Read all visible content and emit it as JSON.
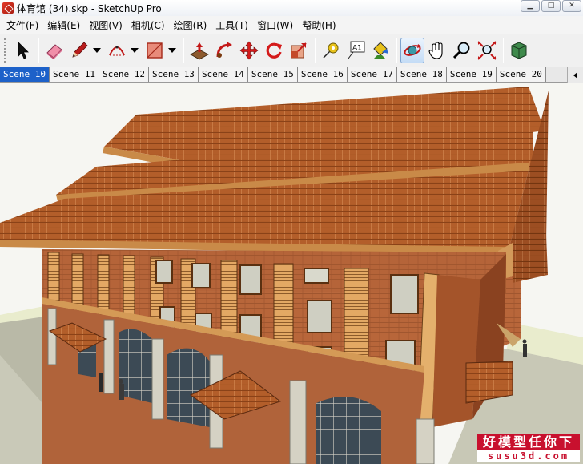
{
  "window": {
    "title": "体育馆 (34).skp - SketchUp Pro",
    "controls": {
      "minimize": "▁",
      "maximize": "□",
      "close": "✕"
    }
  },
  "menu": [
    {
      "label": "文件(F)"
    },
    {
      "label": "编辑(E)"
    },
    {
      "label": "视图(V)"
    },
    {
      "label": "相机(C)"
    },
    {
      "label": "绘图(R)"
    },
    {
      "label": "工具(T)"
    },
    {
      "label": "窗口(W)"
    },
    {
      "label": "帮助(H)"
    }
  ],
  "toolbar": {
    "tools": [
      {
        "icon": "select-icon"
      },
      {
        "icon": "eraser-icon"
      },
      {
        "icon": "pencil-icon",
        "dropdown": true
      },
      {
        "icon": "arc-icon",
        "dropdown": true
      },
      {
        "icon": "rectangle-icon",
        "dropdown": true
      },
      {
        "icon": "push-pull-icon"
      },
      {
        "icon": "follow-me-icon"
      },
      {
        "icon": "move-icon"
      },
      {
        "icon": "rotate-icon"
      },
      {
        "icon": "scale-icon"
      },
      {
        "icon": "tape-measure-icon"
      },
      {
        "icon": "text-icon",
        "label": "A1"
      },
      {
        "icon": "paint-bucket-icon"
      },
      {
        "icon": "orbit-icon",
        "active": true
      },
      {
        "icon": "pan-icon"
      },
      {
        "icon": "zoom-icon"
      },
      {
        "icon": "zoom-extents-icon"
      },
      {
        "icon": "cube-icon"
      }
    ],
    "accent_color": "#1d61c9"
  },
  "scenes": {
    "active_index": 0,
    "tabs": [
      "Scene 10",
      "Scene 11",
      "Scene 12",
      "Scene 13",
      "Scene 14",
      "Scene 15",
      "Scene 16",
      "Scene 17",
      "Scene 18",
      "Scene 19",
      "Scene 20"
    ]
  },
  "watermark": {
    "cn": "好模型任你下",
    "url": "susu3d.com",
    "color": "#c8102e"
  },
  "colors": {
    "sky": "#f6f6f2",
    "roof": "#b45f2c",
    "wall": "#b8663a",
    "ground": "#b9b9a7",
    "grass": "#e9eccd"
  }
}
